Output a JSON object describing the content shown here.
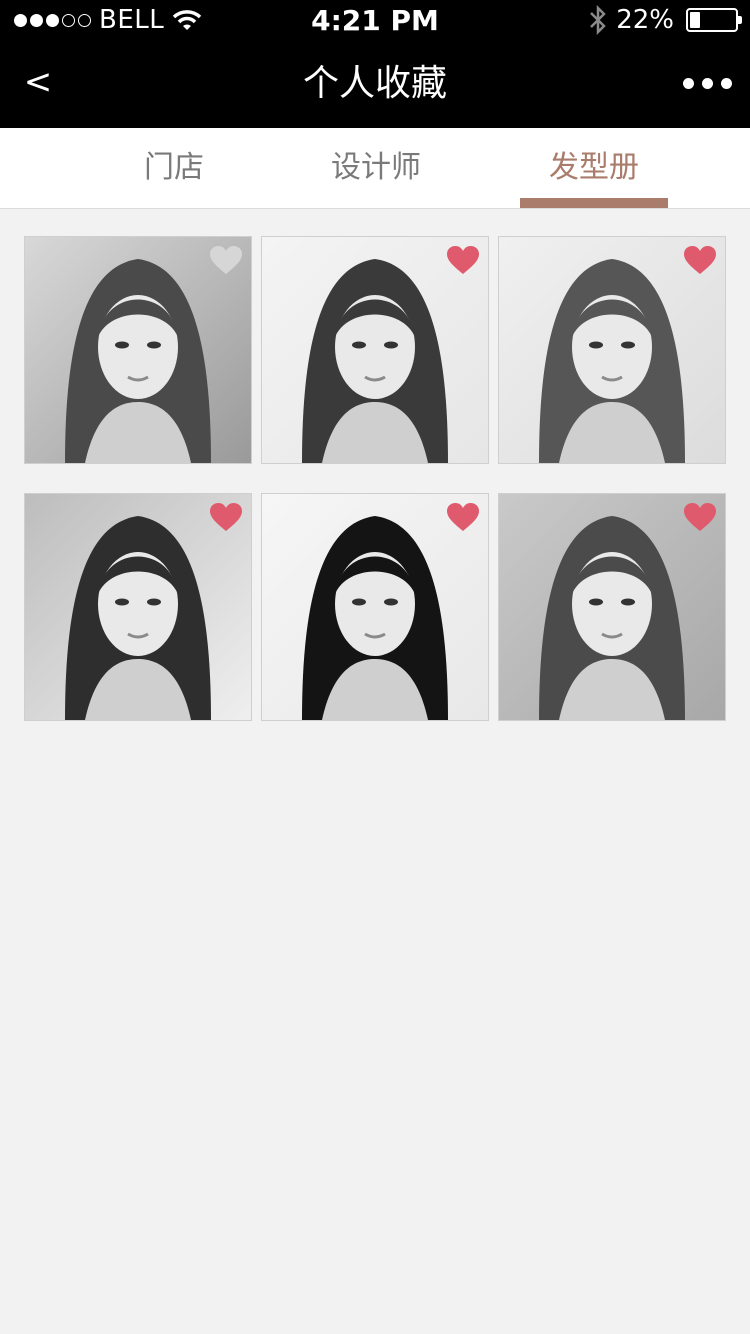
{
  "status_bar": {
    "carrier": "BELL",
    "time": "4:21 PM",
    "battery": "22%",
    "battery_level": 0.22,
    "signal_bars": 3
  },
  "nav": {
    "back_label": "<",
    "title": "个人收藏",
    "more_icon": "more-icon"
  },
  "tabs": [
    {
      "label": "门店",
      "active": false
    },
    {
      "label": "设计师",
      "active": false
    },
    {
      "label": "发型册",
      "active": true
    }
  ],
  "colors": {
    "accent": "#a97c6b",
    "heart_active": "#e05a6e",
    "heart_inactive": "#d6d6d6",
    "bar": "#000000",
    "background": "#f2f2f2"
  },
  "gallery": [
    {
      "favorited": false
    },
    {
      "favorited": true
    },
    {
      "favorited": true
    },
    {
      "favorited": true
    },
    {
      "favorited": true
    },
    {
      "favorited": true
    }
  ]
}
